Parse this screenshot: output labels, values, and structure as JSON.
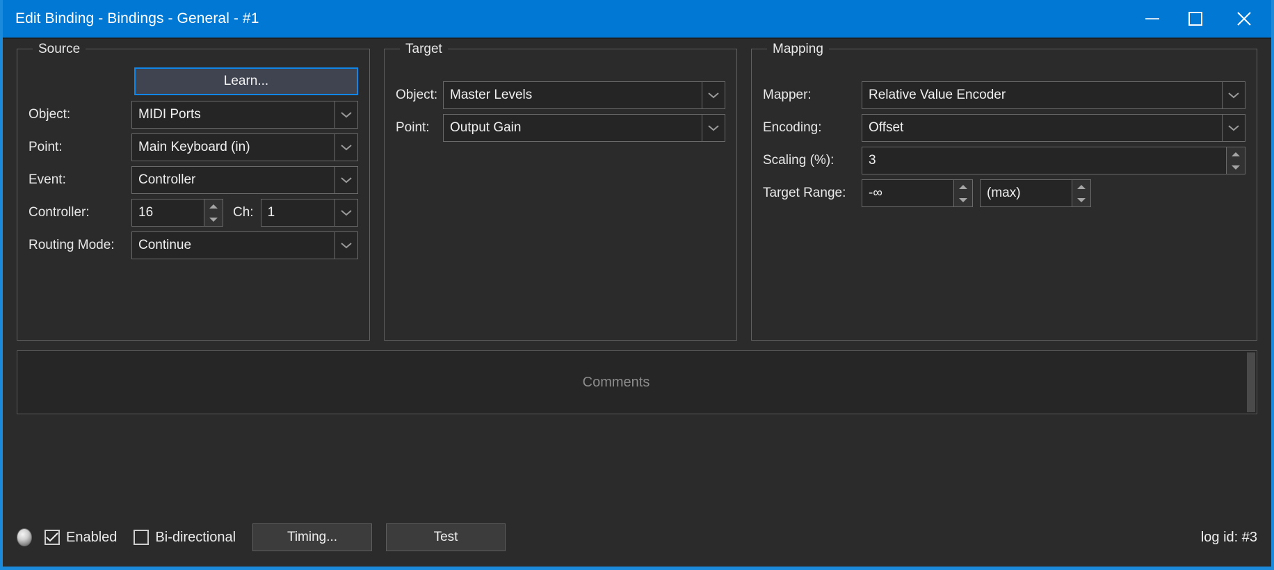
{
  "window": {
    "title": "Edit Binding - Bindings - General - #1",
    "accent_color": "#0078d4",
    "background_color": "#2b2b2b",
    "controls": {
      "minimize": "minimize",
      "maximize": "maximize",
      "close": "close"
    }
  },
  "source": {
    "title": "Source",
    "learn_button": "Learn...",
    "object_label": "Object:",
    "object_value": "MIDI Ports",
    "point_label": "Point:",
    "point_value": "Main Keyboard (in)",
    "event_label": "Event:",
    "event_value": "Controller",
    "controller_label": "Controller:",
    "controller_value": "16",
    "channel_label": "Ch:",
    "channel_value": "1",
    "routing_label": "Routing Mode:",
    "routing_value": "Continue"
  },
  "target": {
    "title": "Target",
    "object_label": "Object:",
    "object_value": "Master Levels",
    "point_label": "Point:",
    "point_value": "Output Gain"
  },
  "mapping": {
    "title": "Mapping",
    "mapper_label": "Mapper:",
    "mapper_value": "Relative Value Encoder",
    "encoding_label": "Encoding:",
    "encoding_value": "Offset",
    "scaling_label": "Scaling (%):",
    "scaling_value": "3",
    "range_label": "Target Range:",
    "range_min_value": "-∞",
    "range_max_value": "(max)"
  },
  "comments": {
    "placeholder": "Comments",
    "value": ""
  },
  "footer": {
    "enabled_label": "Enabled",
    "enabled_checked": true,
    "bidirectional_label": "Bi-directional",
    "bidirectional_checked": false,
    "timing_button": "Timing...",
    "test_button": "Test",
    "log_id": "log id: #3"
  }
}
